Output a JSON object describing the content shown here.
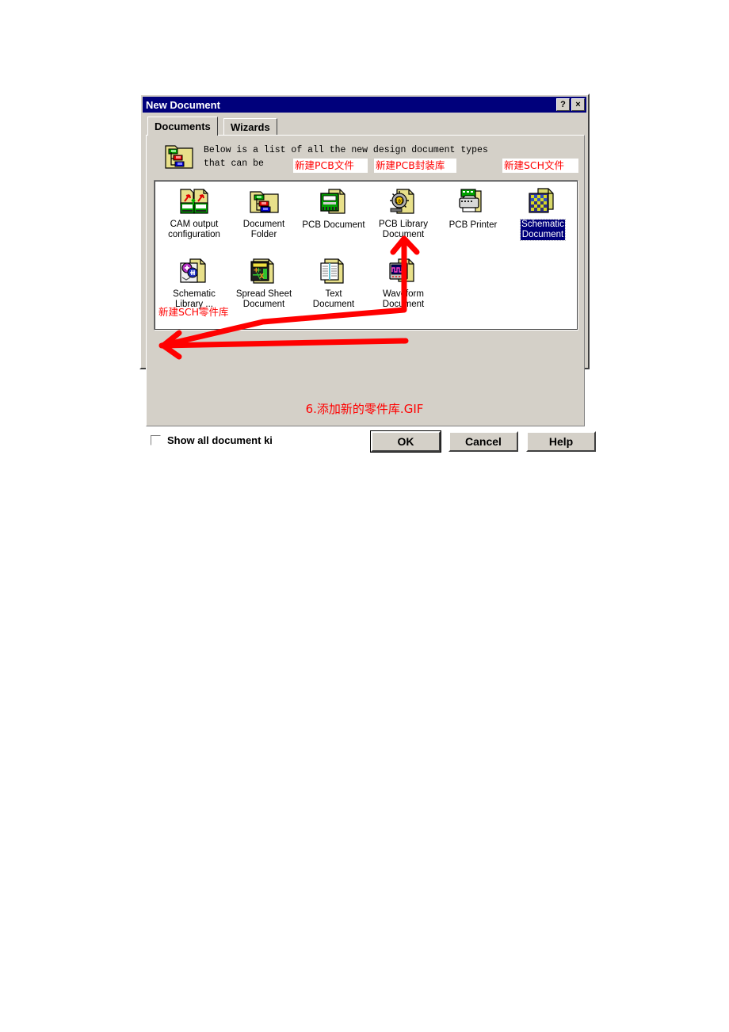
{
  "window": {
    "title": "New Document",
    "help_button": "?",
    "close_button": "×"
  },
  "tabs": [
    {
      "label": "Documents",
      "selected": true
    },
    {
      "label": "Wizards",
      "selected": false
    }
  ],
  "info": {
    "icon": "folder-documents-icon",
    "text": "Below is a list of all the new design document types\nthat can be"
  },
  "documents": [
    {
      "id": "cam-output-configuration",
      "label": "CAM output\nconfiguration",
      "icon": "cam-output-icon",
      "selected": false
    },
    {
      "id": "document-folder",
      "label": "Document\nFolder",
      "icon": "folder-icon",
      "selected": false
    },
    {
      "id": "pcb-document",
      "label": "PCB Document",
      "icon": "pcb-document-icon",
      "selected": false
    },
    {
      "id": "pcb-library-document",
      "label": "PCB Library\nDocument",
      "icon": "pcb-library-icon",
      "selected": false
    },
    {
      "id": "pcb-printer",
      "label": "PCB Printer",
      "icon": "printer-icon",
      "selected": false
    },
    {
      "id": "schematic-document",
      "label": "Schematic\nDocument",
      "icon": "schematic-document-icon",
      "selected": true
    },
    {
      "id": "schematic-library",
      "label": "Schematic\nLibrary ...",
      "icon": "schematic-library-icon",
      "selected": false
    },
    {
      "id": "spread-sheet-document",
      "label": "Spread Sheet\nDocument",
      "icon": "spreadsheet-icon",
      "selected": false
    },
    {
      "id": "text-document",
      "label": "Text\nDocument",
      "icon": "text-document-icon",
      "selected": false
    },
    {
      "id": "waveform-document",
      "label": "Waveform\nDocument",
      "icon": "waveform-icon",
      "selected": false
    }
  ],
  "footer": {
    "checkbox_label": "Show all document ki",
    "checkbox_checked": false,
    "buttons": [
      {
        "id": "ok",
        "label": "OK",
        "default": true
      },
      {
        "id": "cancel",
        "label": "Cancel",
        "default": false
      },
      {
        "id": "help",
        "label": "Help",
        "default": false
      }
    ]
  },
  "annotations": [
    {
      "id": "new-pcb-file",
      "text": "新建PCB文件"
    },
    {
      "id": "new-pcb-footprint-lib",
      "text": "新建PCB封装库"
    },
    {
      "id": "new-sch-file",
      "text": "新建SCH文件"
    },
    {
      "id": "new-sch-part-lib",
      "text": "新建SCH零件库"
    }
  ],
  "caption": "6.添加新的零件库.GIF",
  "colors": {
    "titlebar": "#00007b",
    "dialog_face": "#d4d0c8",
    "selection": "#00007b",
    "annotation_red": "#ff0000"
  }
}
